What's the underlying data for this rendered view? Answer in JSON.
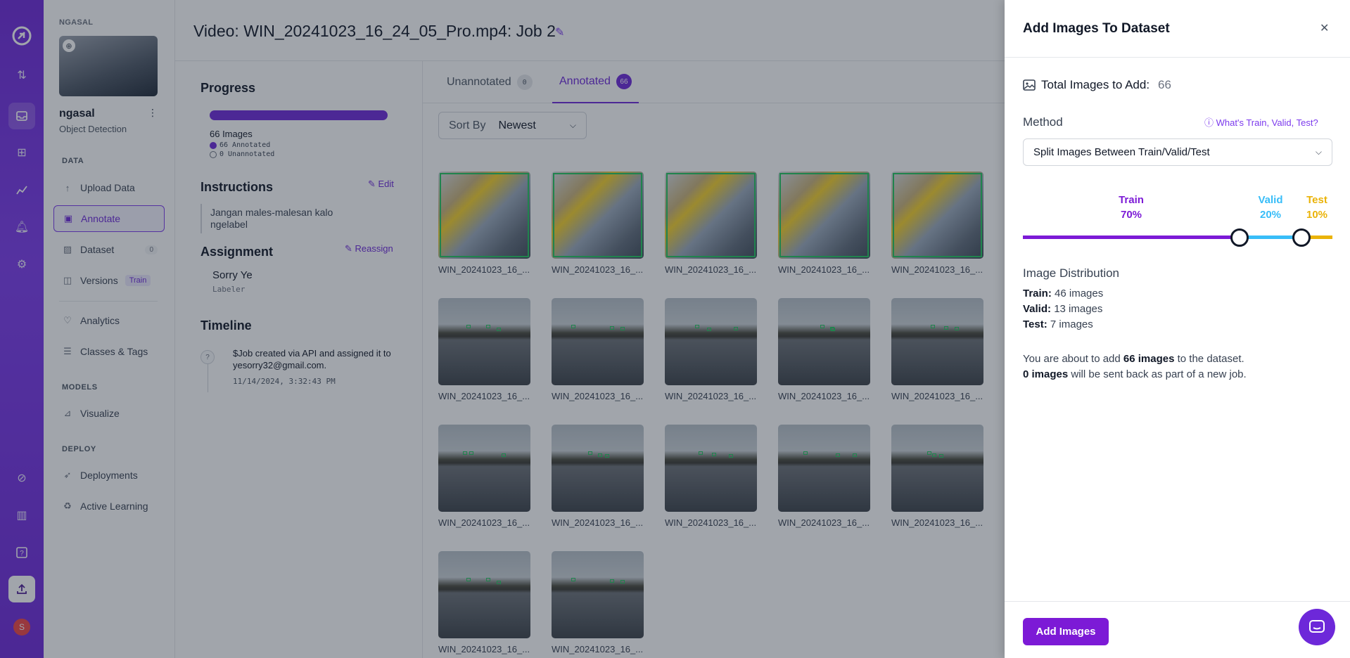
{
  "rail": {
    "icons": [
      "logo-icon",
      "transfer-icon",
      "projects-icon",
      "workflows-icon",
      "analytics-icon",
      "bell-icon",
      "gear-icon",
      "satellite-icon",
      "library-icon",
      "help-icon",
      "upload-icon"
    ],
    "avatar_letter": "S"
  },
  "sidebar": {
    "workspace_label": "NGASAL",
    "project_name": "ngasal",
    "project_type": "Object Detection",
    "sections": {
      "data": "DATA",
      "models": "MODELS",
      "deploy": "DEPLOY"
    },
    "items": [
      {
        "label": "Upload Data",
        "icon": "upload-arrow-icon"
      },
      {
        "label": "Annotate",
        "icon": "annotate-icon",
        "active": true
      },
      {
        "label": "Dataset",
        "icon": "dataset-icon",
        "badge": "0"
      },
      {
        "label": "Versions",
        "icon": "versions-icon",
        "pill": "Train"
      },
      {
        "label": "Analytics",
        "icon": "heart-pulse-icon"
      },
      {
        "label": "Classes & Tags",
        "icon": "list-icon"
      },
      {
        "label": "Visualize",
        "icon": "visualize-icon"
      },
      {
        "label": "Deployments",
        "icon": "rocket-icon"
      },
      {
        "label": "Active Learning",
        "icon": "recycle-icon"
      }
    ]
  },
  "header": {
    "title": "Video: WIN_20241023_16_24_05_Pro.mp4: Job 2"
  },
  "job": {
    "progress_title": "Progress",
    "progress_fraction": 1.0,
    "images_count_label": "66 Images",
    "annotated_label": "66 Annotated",
    "unannotated_label": "0 Unannotated",
    "instructions_title": "Instructions",
    "edit_label": "Edit",
    "instructions_text": "Jangan males-malesan kalo ngelabel",
    "assignment_title": "Assignment",
    "reassign_label": "Reassign",
    "assignee": "Sorry Ye",
    "assignee_role": "Labeler",
    "timeline_title": "Timeline",
    "timeline_icon": "?",
    "timeline_text": "$Job created via API and assigned it to yesorry32@gmail.com.",
    "timeline_time": "11/14/2024, 3:32:43 PM"
  },
  "images": {
    "tabs": [
      {
        "label": "Unannotated",
        "count": "0"
      },
      {
        "label": "Annotated",
        "count": "66",
        "active": true
      }
    ],
    "sort_label": "Sort By",
    "sort_value": "Newest",
    "tiles": [
      {
        "caption": "WIN_20241023_16_...",
        "kind": "person"
      },
      {
        "caption": "WIN_20241023_16_...",
        "kind": "person"
      },
      {
        "caption": "WIN_20241023_16_...",
        "kind": "person"
      },
      {
        "caption": "WIN_20241023_16_...",
        "kind": "person"
      },
      {
        "caption": "WIN_20241023_16_...",
        "kind": "person"
      },
      {
        "caption": "WIN_20241023_16_...",
        "kind": "lake"
      },
      {
        "caption": "WIN_20241023_16_...",
        "kind": "lake"
      },
      {
        "caption": "WIN_20241023_16_...",
        "kind": "lake"
      },
      {
        "caption": "WIN_20241023_16_...",
        "kind": "lake"
      },
      {
        "caption": "WIN_20241023_16_...",
        "kind": "lake"
      },
      {
        "caption": "WIN_20241023_16_...",
        "kind": "lake"
      },
      {
        "caption": "WIN_20241023_16_...",
        "kind": "lake"
      },
      {
        "caption": "WIN_20241023_16_...",
        "kind": "lake"
      },
      {
        "caption": "WIN_20241023_16_...",
        "kind": "lake"
      },
      {
        "caption": "WIN_20241023_16_...",
        "kind": "lake"
      },
      {
        "caption": "WIN_20241023_16_...",
        "kind": "lake"
      },
      {
        "caption": "WIN_20241023_16_...",
        "kind": "lake"
      }
    ]
  },
  "drawer": {
    "title": "Add Images To Dataset",
    "total_label": "Total Images to Add:",
    "total_value": "66",
    "method_label": "Method",
    "help_link": "What's Train, Valid, Test?",
    "method_value": "Split Images Between Train/Valid/Test",
    "split": {
      "train_label": "Train",
      "train_pct": "70%",
      "train_value": 70,
      "train_color": "#7c1ad6",
      "valid_label": "Valid",
      "valid_pct": "20%",
      "valid_value": 20,
      "valid_color": "#38bdf8",
      "test_label": "Test",
      "test_pct": "10%",
      "test_value": 10,
      "test_color": "#eab308"
    },
    "distribution_title": "Image Distribution",
    "train_line_label": "Train:",
    "train_line_value": "46 images",
    "valid_line_label": "Valid:",
    "valid_line_value": "13 images",
    "test_line_label": "Test:",
    "test_line_value": "7 images",
    "note1_pre": "You are about to add ",
    "note1_bold": "66 images",
    "note1_post": " to the dataset.",
    "note2_bold": "0 images",
    "note2_post": " will be sent back as part of a new job.",
    "add_button": "Add Images"
  }
}
